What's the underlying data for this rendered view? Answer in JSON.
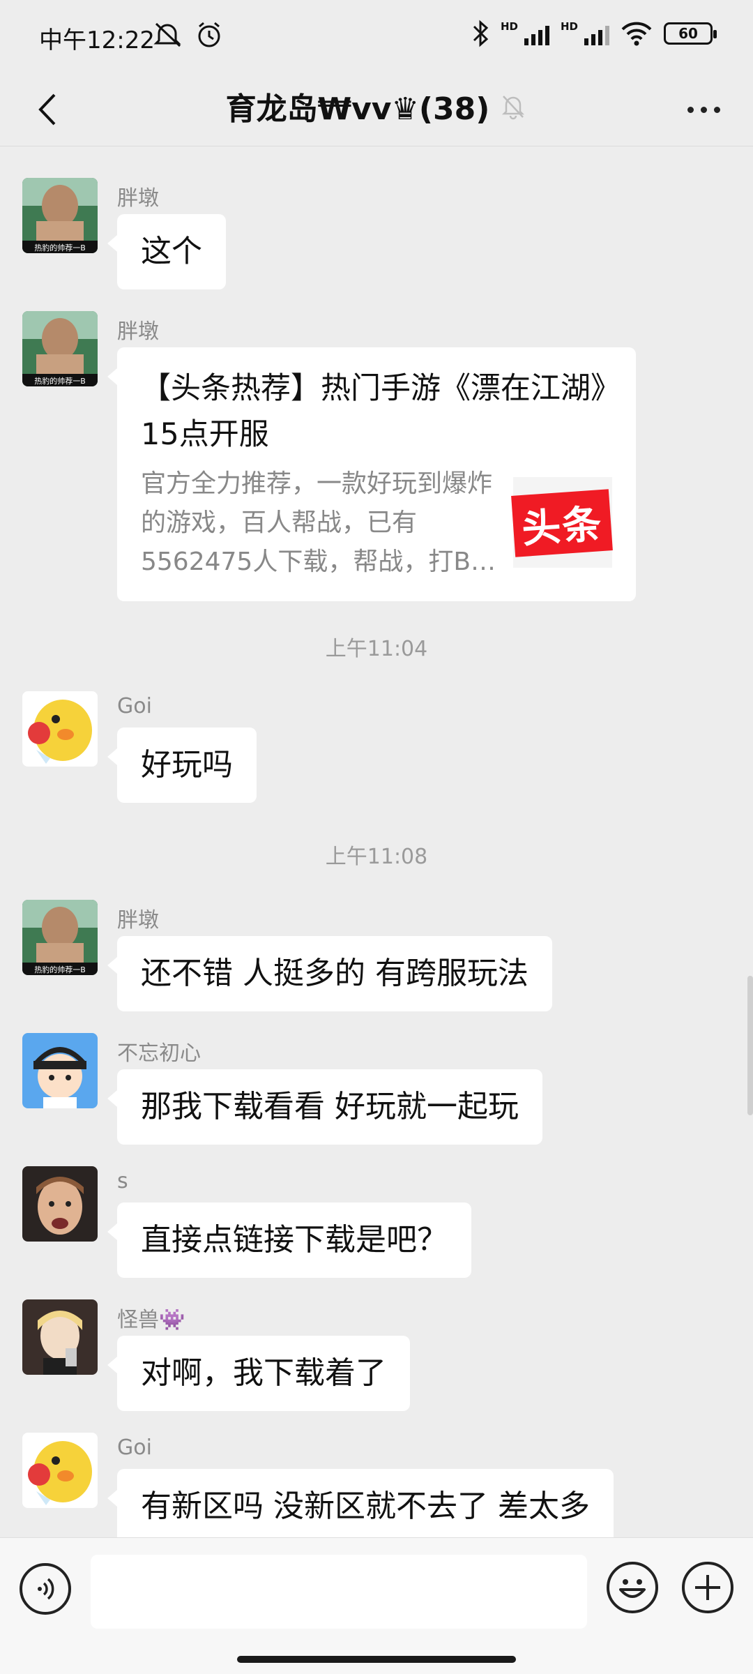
{
  "status_bar": {
    "time": "中午12:22",
    "hd1": "HD",
    "hd2": "HD",
    "battery": "60"
  },
  "header": {
    "title": "育龙岛₩vv♛(38)"
  },
  "messages": [
    {
      "sender": "胖墩",
      "text": "这个"
    },
    {
      "sender": "胖墩",
      "card": {
        "title": "【头条热荐】热门手游《漂在江湖》15点开服",
        "desc": "官方全力推荐，一款好玩到爆炸的游戏，百人帮战，已有5562475人下载，帮战，打B…",
        "logo_text": "头条"
      }
    },
    {
      "time": "上午11:04"
    },
    {
      "sender": "Goi",
      "text": "好玩吗"
    },
    {
      "time": "上午11:08"
    },
    {
      "sender": "胖墩",
      "text": "还不错 人挺多的 有跨服玩法"
    },
    {
      "sender": "不忘初心",
      "text": "那我下载看看 好玩就一起玩"
    },
    {
      "sender": "s",
      "text": "直接点链接下载是吧？"
    },
    {
      "sender": "怪兽👾",
      "text": "对啊，我下载着了"
    },
    {
      "sender": "Goi",
      "text": "有新区吗 没新区就不去了 差太多"
    }
  ],
  "avatar_caption": "热豹的帅荐一B",
  "colors": {
    "background": "#ededed",
    "bubble": "#ffffff",
    "toutiao_red": "#f01b24"
  },
  "icons": [
    "back-icon",
    "mute-icon",
    "more-icon",
    "voice-icon",
    "emoji-icon",
    "plus-icon"
  ]
}
